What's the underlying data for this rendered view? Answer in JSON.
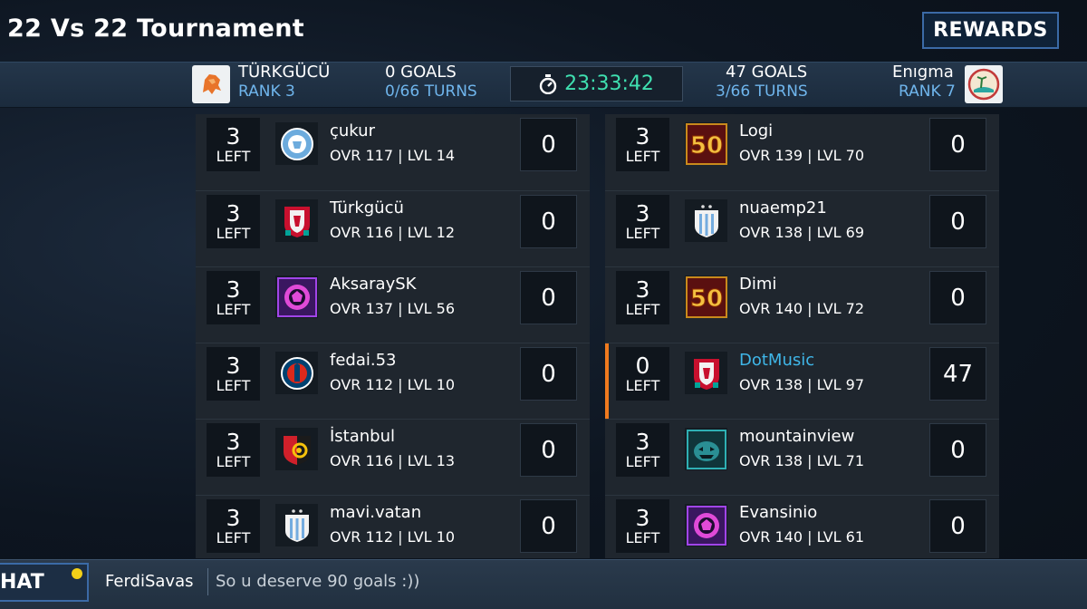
{
  "header": {
    "title": "22 Vs 22 Tournament",
    "rewards_label": "REWARDS"
  },
  "scoreboard": {
    "home": {
      "name": "TÜRKGÜCÜ",
      "rank": "RANK 3",
      "goals": "0 GOALS",
      "turns": "0/66 TURNS",
      "crest": "lion-crest-icon"
    },
    "away": {
      "name": "Enıgma",
      "rank": "RANK 7",
      "goals": "47 GOALS",
      "turns": "3/66 TURNS",
      "crest": "beach-crest-icon"
    },
    "timer": "23:33:42",
    "timer_icon": "stopwatch-icon"
  },
  "left_players": [
    {
      "left_count": "3",
      "left_label": "LEFT",
      "name": "çukur",
      "stats": "OVR 117 | LVL 14",
      "score": "0",
      "avatar": "manchester-city-crest-icon"
    },
    {
      "left_count": "3",
      "left_label": "LEFT",
      "name": "Türkgücü",
      "stats": "OVR 116 | LVL 12",
      "score": "0",
      "avatar": "liverpool-crest-icon"
    },
    {
      "left_count": "3",
      "left_label": "LEFT",
      "name": "AksaraySK",
      "stats": "OVR 137 | LVL 56",
      "score": "0",
      "avatar": "purple-ball-badge-icon"
    },
    {
      "left_count": "3",
      "left_label": "LEFT",
      "name": "fedai.53",
      "stats": "OVR 112 | LVL 10",
      "score": "0",
      "avatar": "psg-crest-icon"
    },
    {
      "left_count": "3",
      "left_label": "LEFT",
      "name": "İstanbul",
      "stats": "OVR 116 | LVL 13",
      "score": "0",
      "avatar": "istanbulspor-crest-icon"
    },
    {
      "left_count": "3",
      "left_label": "LEFT",
      "name": "mavi.vatan",
      "stats": "OVR 112 | LVL 10",
      "score": "0",
      "avatar": "argentina-crest-icon"
    }
  ],
  "right_players": [
    {
      "left_count": "3",
      "left_label": "LEFT",
      "name": "Logi",
      "stats": "OVR 139 | LVL 70",
      "score": "0",
      "avatar": "fifty-badge-icon",
      "badge_text": "50"
    },
    {
      "left_count": "3",
      "left_label": "LEFT",
      "name": "nuaemp21",
      "stats": "OVR 138 | LVL 69",
      "score": "0",
      "avatar": "argentina-crest-icon"
    },
    {
      "left_count": "3",
      "left_label": "LEFT",
      "name": "Dimi",
      "stats": "OVR 140 | LVL 72",
      "score": "0",
      "avatar": "fifty-badge-icon",
      "badge_text": "50"
    },
    {
      "left_count": "0",
      "left_label": "LEFT",
      "name": "DotMusic",
      "stats": "OVR 138 | LVL 97",
      "score": "47",
      "avatar": "liverpool-crest-icon"
    },
    {
      "left_count": "3",
      "left_label": "LEFT",
      "name": "mountainview",
      "stats": "OVR 138 | LVL 71",
      "score": "0",
      "avatar": "pumpkin-badge-icon"
    },
    {
      "left_count": "3",
      "left_label": "LEFT",
      "name": "Evansinio",
      "stats": "OVR 140 | LVL 61",
      "score": "0",
      "avatar": "purple-ball-badge-icon"
    }
  ],
  "chat": {
    "button_label": "HAT",
    "user": "FerdiSavas",
    "message": "So u deserve 90 goals :))"
  },
  "colors": {
    "accent_blue": "#6fb5ec",
    "timer_green": "#3fe0b0",
    "active_orange": "#f07a1e",
    "highlight_name": "#3fb6e8"
  }
}
